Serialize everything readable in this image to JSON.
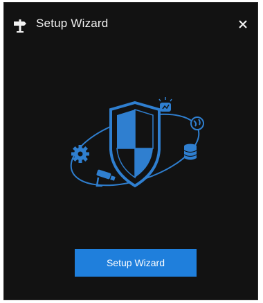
{
  "dialog": {
    "title": "Setup Wizard",
    "title_icon": "signpost-icon",
    "close_icon": "close-icon",
    "illustration_icons": [
      "shield-icon",
      "gear-icon",
      "alarm-icon",
      "globe-icon",
      "database-icon",
      "camera-icon"
    ],
    "button_label": "Setup Wizard"
  },
  "colors": {
    "background": "#121212",
    "accent": "#1f7fdc",
    "illustration_blue": "#2f7fd0"
  }
}
